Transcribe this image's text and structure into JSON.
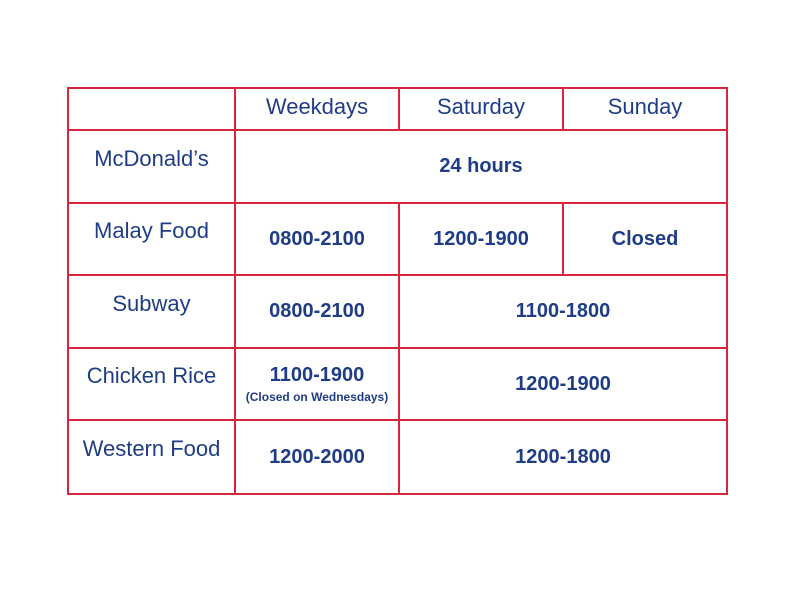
{
  "columns": {
    "weekdays": "Weekdays",
    "saturday": "Saturday",
    "sunday": "Sunday"
  },
  "rows": [
    {
      "name": "McDonald’s",
      "all_days": "24 hours"
    },
    {
      "name": "Malay Food",
      "weekdays": "0800-2100",
      "saturday": "1200-1900",
      "sunday": "Closed"
    },
    {
      "name": "Subway",
      "weekdays": "0800-2100",
      "weekend": "1100-1800"
    },
    {
      "name": "Chicken Rice",
      "weekdays": "1100-1900",
      "weekdays_note": "(Closed on Wednesdays)",
      "weekend": "1200-1900"
    },
    {
      "name": "Western Food",
      "weekdays": "1200-2000",
      "weekend": "1200-1800"
    }
  ],
  "colors": {
    "border": "#d7263d",
    "text": "#1f3d86"
  }
}
